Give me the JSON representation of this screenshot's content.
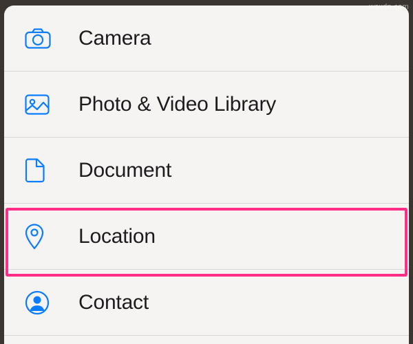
{
  "menu": {
    "items": [
      {
        "id": "camera",
        "label": "Camera"
      },
      {
        "id": "photo-video",
        "label": "Photo & Video Library"
      },
      {
        "id": "document",
        "label": "Document"
      },
      {
        "id": "location",
        "label": "Location"
      },
      {
        "id": "contact",
        "label": "Contact"
      }
    ]
  },
  "colors": {
    "iconBlue": "#0a7cff",
    "highlight": "#ff2d86",
    "sheetBg": "#f5f4f2",
    "divider": "#d8d7d5"
  },
  "watermark": "wsxdn.com"
}
